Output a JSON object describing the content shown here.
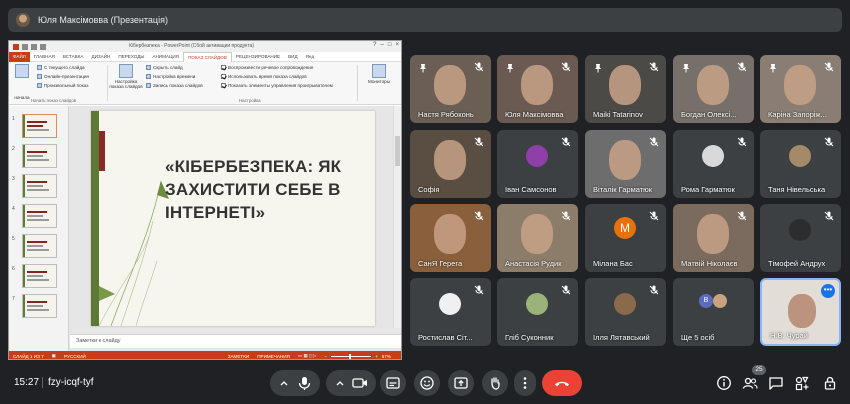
{
  "presenter_bar": {
    "title": "Юля Максімовва (Презентація)"
  },
  "powerpoint": {
    "window_title": "Кібербезпека - PowerPoint (Сбой активации продукта)",
    "tabs": [
      "ФАЙЛ",
      "ГЛАВНАЯ",
      "ВСТАВКА",
      "ДИЗАЙН",
      "ПЕРЕХОДЫ",
      "АНИМАЦИЯ",
      "ПОКАЗ СЛАЙДОВ",
      "РЕЦЕНЗИРОВАНИЕ",
      "ВИД",
      "Янд"
    ],
    "active_tab": "ПОКАЗ СЛАЙДОВ",
    "ribbon": {
      "start_big": "начала",
      "from_current": "С текущего слайда",
      "online": "Онлайн-презентация",
      "custom": "Произвольный показ",
      "group1_label": "Начать показ слайдов",
      "setup_big": "Настройка показа слайдов",
      "hide_slide": "Скрыть слайд",
      "rehearse": "Настройка времени",
      "record": "Запись показа слайдов",
      "play_narration": "Воспроизвести речевое сопровождение",
      "use_timings": "Использовать время показа слайдов",
      "show_controls": "Показать элементы управления проигрывателем",
      "group2_label": "Настройка",
      "monitors": "Мониторы"
    },
    "slide_numbers": [
      "1",
      "2",
      "3",
      "4",
      "5",
      "6",
      "7"
    ],
    "slide_title": "«КІБЕРБЕЗПЕКА: ЯК ЗАХИСТИТИ СЕБЕ В ІНТЕРНЕТІ»",
    "notes_placeholder": "Заметки к слайду",
    "status": {
      "slide_info": "СЛАЙД 1 ИЗ 7",
      "language": "РУССКИЙ",
      "notes": "ЗАМЕТКИ",
      "comments": "ПРИМЕЧАНИЯ",
      "zoom": "67%"
    }
  },
  "participants": [
    {
      "name": "Настя Рябоконь",
      "kind": "video",
      "bg": "#6b5f55"
    },
    {
      "name": "Юля Максімовва",
      "kind": "video",
      "bg": "#6a5a52"
    },
    {
      "name": "Maiki Tatarinov",
      "kind": "video",
      "bg": "#4b4a46"
    },
    {
      "name": "Богдан Олексі...",
      "kind": "video",
      "bg": "#77706a"
    },
    {
      "name": "Каріна Запоріж...",
      "kind": "video",
      "bg": "#8a7e74"
    },
    {
      "name": "Софія",
      "kind": "video",
      "bg": "#5a4e43"
    },
    {
      "name": "Іван Самсонов",
      "kind": "avatar",
      "bg": "#3c4043",
      "avatar": "#8e3fa8"
    },
    {
      "name": "Віталік Гарматюк",
      "kind": "video",
      "bg": "#6d6d6d"
    },
    {
      "name": "Рома Гарматюк",
      "kind": "avatar",
      "bg": "#3c4043",
      "avatar": "#d9d9d9"
    },
    {
      "name": "Таня Нівельська",
      "kind": "avatar",
      "bg": "#3c4043",
      "avatar": "#a58a6a"
    },
    {
      "name": "СанЯ Герега",
      "kind": "video",
      "bg": "#8a5f3b"
    },
    {
      "name": "Анастасія Рудик",
      "kind": "video",
      "bg": "#8c7d6a"
    },
    {
      "name": "Мілана Бас",
      "kind": "letter",
      "bg": "#3c4043",
      "letter": "М"
    },
    {
      "name": "Матвій Ніколаєв",
      "kind": "video",
      "bg": "#7b6b5e"
    },
    {
      "name": "Тімофей Андрух",
      "kind": "avatar",
      "bg": "#3c4043",
      "avatar": "#2d2d2d"
    },
    {
      "name": "Ростислав Сіт...",
      "kind": "avatar",
      "bg": "#3c4043",
      "avatar": "#f0f0f0"
    },
    {
      "name": "Гліб Суконник",
      "kind": "avatar",
      "bg": "#3c4043",
      "avatar": "#9bb27a"
    },
    {
      "name": "Ілля Лятавський",
      "kind": "avatar",
      "bg": "#3c4043",
      "avatar": "#8a6a4a"
    },
    {
      "name": "Ще 5 осіб",
      "kind": "more",
      "bg": "#3c4043"
    },
    {
      "name": "Н.В. Чурай",
      "kind": "self",
      "bg": "#e2ddd6"
    }
  ],
  "more_avatar_letter": "В",
  "bottom": {
    "time": "15:27",
    "meeting_code": "fzy-icqf-tyf",
    "participants_count": "25"
  },
  "colors": {
    "end_call": "#ea4335",
    "accent_blue": "#8ab4f8",
    "ppt_red": "#c43e1c"
  }
}
